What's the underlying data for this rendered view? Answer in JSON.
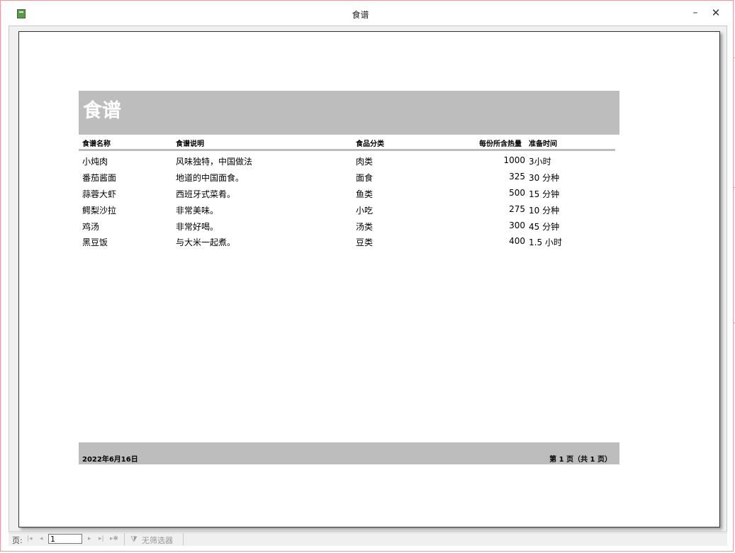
{
  "window": {
    "title": "食谱",
    "minimize_glyph": "–",
    "close_glyph": "✕"
  },
  "report": {
    "title": "食谱",
    "columns": {
      "name": "食谱名称",
      "desc": "食谱说明",
      "category": "食品分类",
      "calories": "每份所含热量",
      "time": "准备时间"
    },
    "rows": [
      {
        "name": "小炖肉",
        "desc": "风味独特，中国做法",
        "category": "肉类",
        "calories": "1000",
        "time": "3小时"
      },
      {
        "name": "番茄酱面",
        "desc": "地道的中国面食。",
        "category": "面食",
        "calories": "325",
        "time": "30 分种"
      },
      {
        "name": "蒜蓉大虾",
        "desc": "西班牙式菜肴。",
        "category": "鱼类",
        "calories": "500",
        "time": "15 分钟"
      },
      {
        "name": "鳄梨沙拉",
        "desc": "非常美味。",
        "category": "小吃",
        "calories": "275",
        "time": "10 分种"
      },
      {
        "name": "鸡汤",
        "desc": "非常好喝。",
        "category": "汤类",
        "calories": "300",
        "time": "45 分钟"
      },
      {
        "name": "黑豆饭",
        "desc": "与大米一起煮。",
        "category": "豆类",
        "calories": "400",
        "time": "1.5 小时"
      }
    ],
    "footer": {
      "date": "2022年6月16日",
      "page": "第 1 页（共 1 页）"
    }
  },
  "statusbar": {
    "page_label": "页:",
    "page_value": "1",
    "nav_first": "|◂",
    "nav_prev": "◂",
    "nav_next": "▸",
    "nav_last": "▸|",
    "nav_new": "▸✱",
    "filter_label": "无筛选器"
  },
  "colors": {
    "band": "#bdbdbd",
    "title_text": "#ffffff",
    "window_border": "#d9a0a8"
  },
  "icons": [
    "app-icon",
    "minimize-icon",
    "close-icon",
    "filter-icon"
  ]
}
